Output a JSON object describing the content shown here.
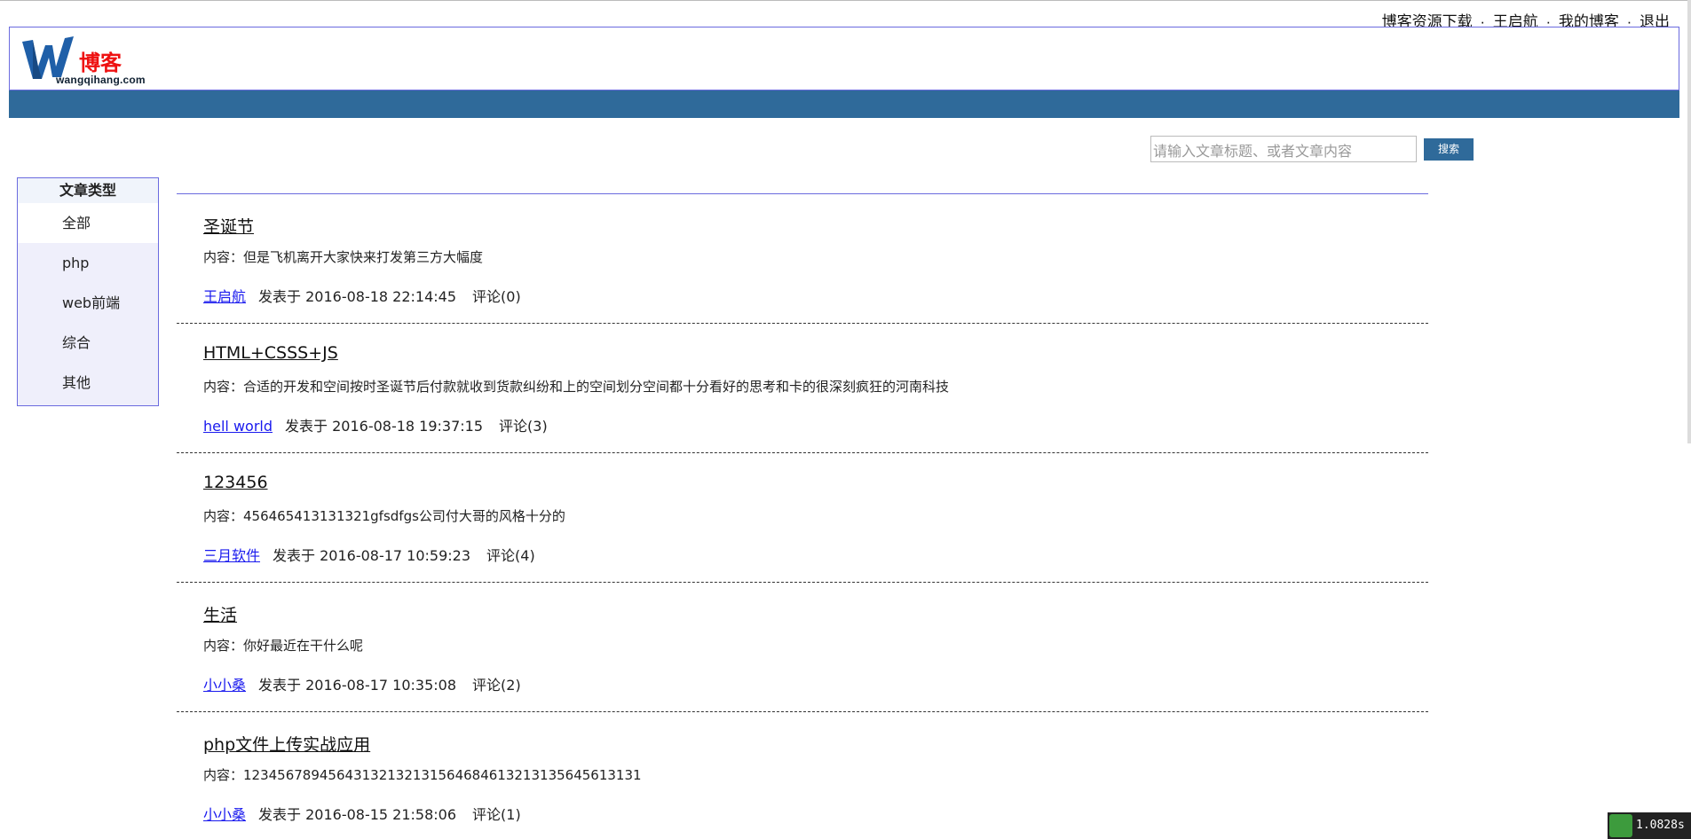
{
  "topbar": {
    "links": [
      "博客资源下载",
      "王启航",
      "我的博客",
      "退出"
    ],
    "separator": "·"
  },
  "logo": {
    "cn": "博客",
    "en": "wangqihang.com"
  },
  "search": {
    "placeholder": "请输入文章标题、或者文章内容",
    "button": "搜索"
  },
  "sidebar": {
    "title": "文章类型",
    "items": [
      "全部",
      "php",
      "web前端",
      "综合",
      "其他"
    ]
  },
  "articles": [
    {
      "title": "圣诞节",
      "content": "内容：但是飞机离开大家快来打发第三方大幅度",
      "author": "王启航",
      "date": "发表于 2016-08-18 22:14:45",
      "comments": "评论(0)"
    },
    {
      "title": "HTML+CSSS+JS",
      "content": "内容：合适的开发和空间按时圣诞节后付款就收到货款纠纷和上的空间划分空间都十分看好的思考和卡的很深刻疯狂的河南科技",
      "author": "hell world",
      "date": "发表于 2016-08-18 19:37:15",
      "comments": "评论(3)"
    },
    {
      "title": "123456",
      "content": "内容：456465413131321gfsdfgs公司付大哥的风格十分的",
      "author": "三月软件",
      "date": "发表于 2016-08-17 10:59:23",
      "comments": "评论(4)"
    },
    {
      "title": "生活",
      "content": "内容：你好最近在干什么呢",
      "author": "小小桑",
      "date": "发表于 2016-08-17 10:35:08",
      "comments": "评论(2)"
    },
    {
      "title": "php文件上传实战应用",
      "content": "内容：12345678945643132132131564684613213135645613131",
      "author": "小小桑",
      "date": "发表于 2016-08-15 21:58:06",
      "comments": "评论(1)"
    }
  ],
  "timer": "1.0828s",
  "colors": {
    "navbar": "#2f6a9a",
    "border": "#6b6bdf",
    "link": "#1a1aee",
    "logo_cn": "#e11111"
  }
}
